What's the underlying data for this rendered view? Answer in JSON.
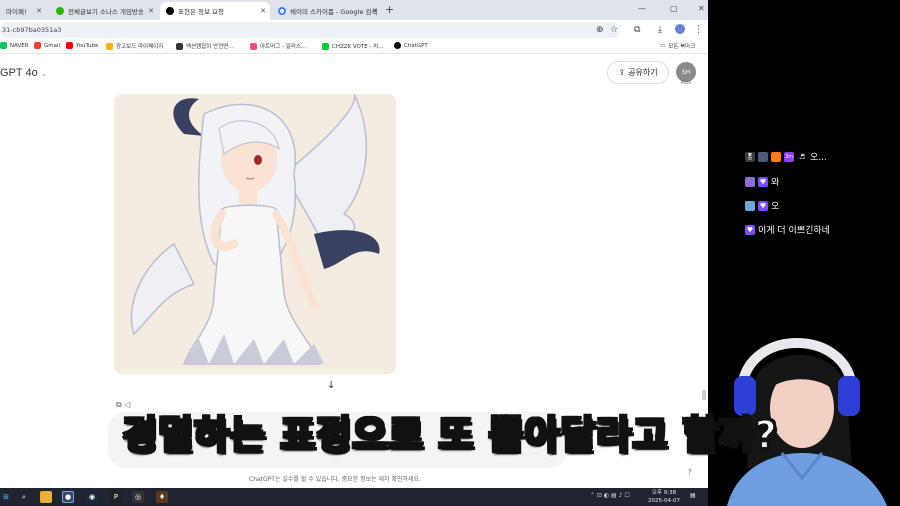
{
  "browser": {
    "tabs": [
      {
        "label": "마이페!",
        "active": false,
        "color": "#999999"
      },
      {
        "label": "전체글보기 소나스 개임방송",
        "active": false,
        "color": "#2db400"
      },
      {
        "label": "표현은 정보 요청",
        "active": true,
        "color": "#000000"
      },
      {
        "label": "쉐이미 스카이폼 - Google 검색",
        "active": false,
        "color": "#4285f4"
      }
    ],
    "new_tab": "+",
    "url": "31-cb97ba0351a3",
    "bookmarks": [
      {
        "label": "NAVER",
        "color": "#03c75a"
      },
      {
        "label": "Gmail",
        "color": "#ea4335"
      },
      {
        "label": "YouTube",
        "color": "#ff0000"
      },
      {
        "label": "광고보드 마이페이지",
        "color": "#f5b400"
      },
      {
        "label": "액션캠잡이 안전면...",
        "color": "#333333"
      },
      {
        "label": "아트머그 - 일러스...",
        "color": "#e94e77"
      },
      {
        "label": "CHZZK VOTE - 치...",
        "color": "#00c73c"
      },
      {
        "label": "ChatGPT",
        "color": "#000000"
      }
    ],
    "bookmarks_folder": "모든 북마크"
  },
  "chatgpt": {
    "model": "GPT 4o",
    "share_label": "공유하기",
    "avatar_initials": "SH",
    "avatar_plan": "PLUS",
    "scroll_arrow": "↓",
    "disclaimer": "ChatGPT는 실수를 할 수 있습니다. 중요한 정보는 재차 확인하세요.",
    "help": "?"
  },
  "taskbar": {
    "time": "오후 9:38",
    "date": "2025-04-07"
  },
  "chat_messages": [
    {
      "text": "오...",
      "badges": [
        "🎖",
        "📦",
        "🔥",
        "3m",
        "♬"
      ]
    },
    {
      "text": "와",
      "badges": [
        "👾",
        "♥"
      ]
    },
    {
      "text": "오",
      "badges": [
        "🐟",
        "♥"
      ]
    },
    {
      "text": "이게 더 이쁘긴하네",
      "badges": [
        "♥"
      ]
    }
  ],
  "subtitle": "경멸하는 표정으로 또 뽑아달라고 할까?",
  "colors": {
    "tab_strip": "#dfe3eb",
    "taskbar": "#1f2430",
    "chat_bg": "#000000",
    "heart_badge": "#7b4dff"
  }
}
